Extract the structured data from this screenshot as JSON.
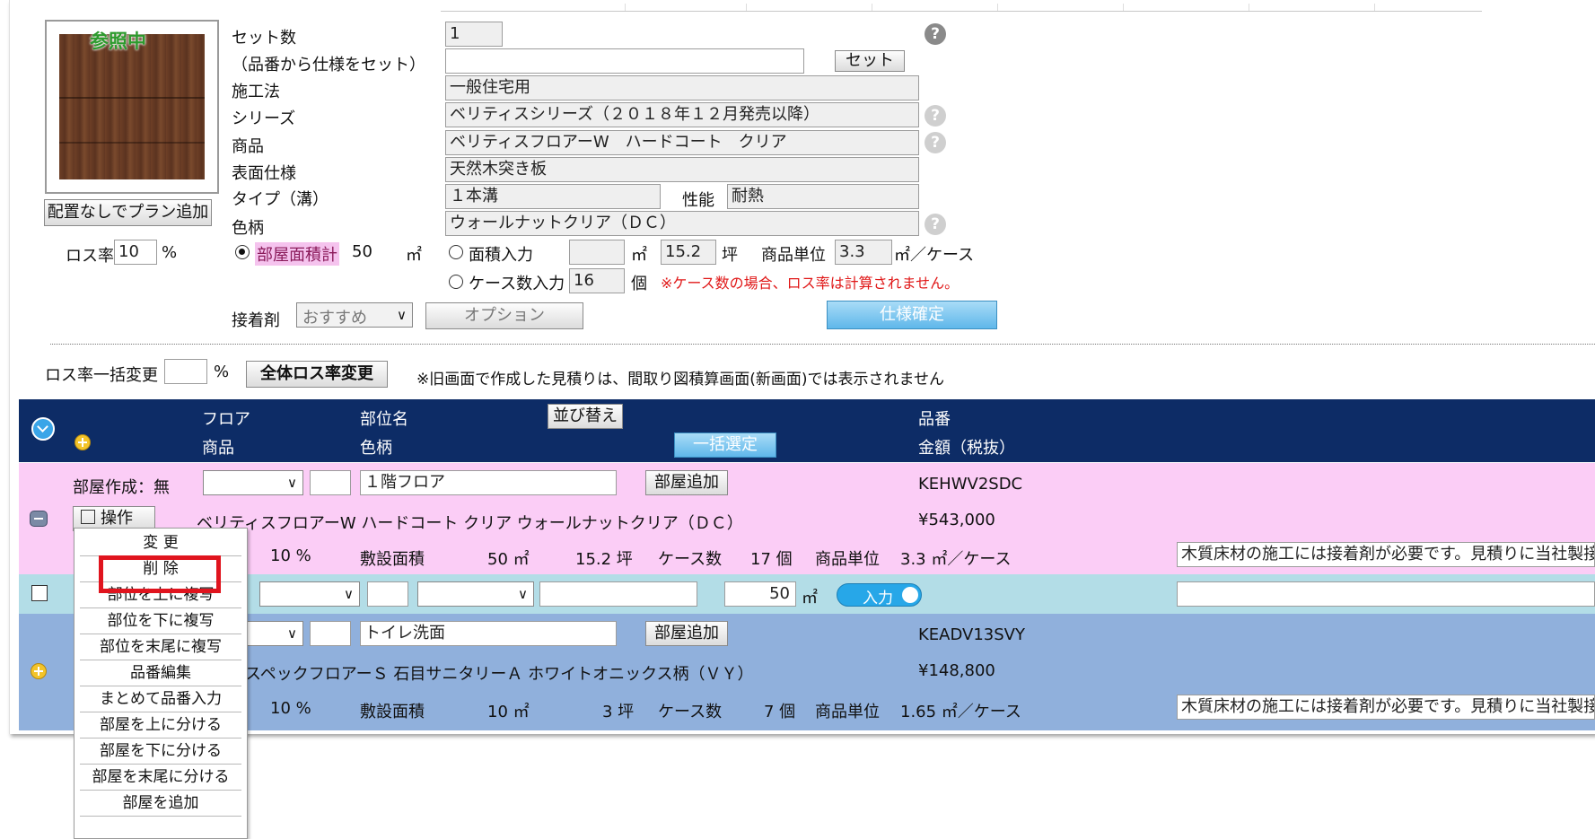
{
  "thumbnail": {
    "status": "参照中"
  },
  "spec": {
    "set_count_label": "セット数",
    "set_count_value": "1",
    "product_code_label": "（品番から仕様をセット）",
    "set_button": "セット",
    "method_label": "施工法",
    "method_value": "一般住宅用",
    "series_label": "シリーズ",
    "series_value": "ベリティスシリーズ（２０１８年１２月発売以降）",
    "product_label": "商品",
    "product_value": "ベリティスフロアーW　ハードコート　クリア",
    "surface_label": "表面仕様",
    "surface_value": "天然木突き板",
    "type_label": "タイプ（溝）",
    "type_value": "１本溝",
    "performance_label": "性能",
    "performance_value": "耐熱",
    "color_label": "色柄",
    "color_value": "ウォールナットクリア（ＤＣ）",
    "help": "?"
  },
  "add_plan_button": "配置なしでプラン追加",
  "loss_rate": {
    "label": "ロス率",
    "value": "10",
    "unit": "%"
  },
  "area": {
    "room_total_label": "部屋面積計",
    "room_total_value": "50",
    "unit_m2": "㎡",
    "area_input_label": "面積入力",
    "area_m2_value": "",
    "tsubo_value": "15.2",
    "tsubo_unit": "坪",
    "unit_label": "商品単位",
    "unit_value": "3.3",
    "per_case": "㎡／ケース",
    "case_input_label": "ケース数入力",
    "case_value": "16",
    "case_unit": "個",
    "case_note": "※ケース数の場合、ロス率は計算されません。"
  },
  "adhesive": {
    "label": "接着剤",
    "value": "おすすめ"
  },
  "option_button": "オプション",
  "confirm_button": "仕様確定",
  "bulk_loss": {
    "label": "ロス率一括変更",
    "value": "",
    "unit": "%",
    "button": "全体ロス率変更",
    "note": "※旧画面で作成した見積りは、間取り図積算画面(新画面)では表示されません"
  },
  "table_header": {
    "floor": "フロア",
    "product": "商品",
    "part_name": "部位名",
    "color": "色柄",
    "sort_button": "並び替え",
    "bulk_select_button": "一括選定",
    "code": "品番",
    "amount": "金額（税抜）"
  },
  "row1": {
    "room_creation": "部屋作成：無",
    "floor_name": "１階フロア",
    "add_room_button": "部屋追加",
    "code": "KEHWV2SDC",
    "operate_button": "操作",
    "product_desc": "ベリティスフロアーW  ハードコート  クリア  ウォールナットクリア（ＤＣ）",
    "amount": "¥543,000",
    "loss": "10 %",
    "area_label": "敷設面積",
    "area": "50 ㎡",
    "tsubo": "15.2 坪",
    "case_label": "ケース数",
    "cases": "17 個",
    "unit_label": "商品単位",
    "unit": "3.3 ㎡／ケース",
    "note": "木質床材の施工には接着剤が必要です。見積りに当社製接"
  },
  "row_input": {
    "value": "50",
    "unit": "㎡",
    "toggle": "入力"
  },
  "row2": {
    "floor_name": "トイレ洗面",
    "add_room_button": "部屋追加",
    "code": "KEADV13SVY",
    "product_desc": "スペックフロアーＳ  石目サニタリーＡ  ホワイトオニックス柄（ＶＹ）",
    "amount": "¥148,800",
    "loss": "10 %",
    "area_label": "敷設面積",
    "area": "10 ㎡",
    "tsubo": "3 坪",
    "case_label": "ケース数",
    "cases": "7 個",
    "unit_label": "商品単位",
    "unit": "1.65 ㎡／ケース",
    "note": "木質床材の施工には接着剤が必要です。見積りに当社製接"
  },
  "context_menu": {
    "items": [
      "変 更",
      "削 除",
      "部位を上に複写",
      "部位を下に複写",
      "部位を末尾に複写",
      "品番編集",
      "まとめて品番入力",
      "部屋を上に分ける",
      "部屋を下に分ける",
      "部屋を末尾に分ける",
      "部屋を追加"
    ],
    "highlighted": "削 除"
  }
}
